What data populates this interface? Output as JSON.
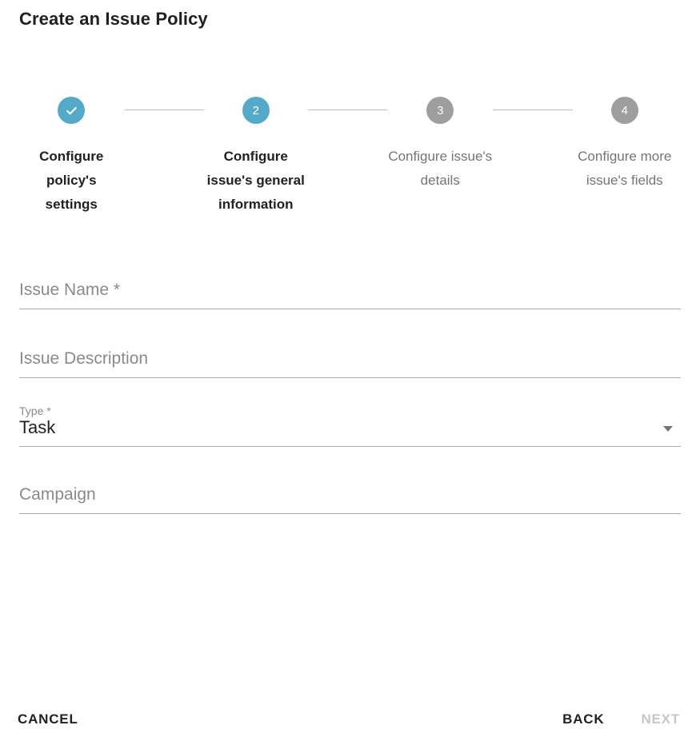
{
  "header": {
    "title": "Create an Issue Policy"
  },
  "colors": {
    "accent": "#54a9c8",
    "inactive": "#9e9e9e",
    "connector": "#bdbdbd",
    "underline": "#ababab",
    "text_primary": "#212121",
    "text_muted": "#757575",
    "placeholder": "#8a8a8a",
    "disabled": "#c6c6c6"
  },
  "stepper": {
    "steps": [
      {
        "number": "1",
        "indicator": "check-icon",
        "label": "Configure policy's settings",
        "state": "completed"
      },
      {
        "number": "2",
        "indicator": "2",
        "label": "Configure issue's general information",
        "state": "active"
      },
      {
        "number": "3",
        "indicator": "3",
        "label": "Configure issue's details",
        "state": "inactive"
      },
      {
        "number": "4",
        "indicator": "4",
        "label": "Configure more issue's fields",
        "state": "inactive"
      }
    ]
  },
  "form": {
    "fields": [
      {
        "name": "issue-name",
        "kind": "text",
        "placeholder": "Issue Name *",
        "label": "Issue Name *",
        "value": "",
        "required": true
      },
      {
        "name": "issue-description",
        "kind": "text",
        "placeholder": "Issue Description",
        "label": "Issue Description",
        "value": "",
        "required": false
      },
      {
        "name": "type",
        "kind": "select",
        "label": "Type *",
        "value": "Task",
        "required": true,
        "icon": "chevron-down-icon"
      },
      {
        "name": "campaign",
        "kind": "text",
        "placeholder": "Campaign",
        "label": "Campaign",
        "value": "",
        "required": false
      }
    ]
  },
  "footer": {
    "cancel_label": "CANCEL",
    "back_label": "BACK",
    "next_label": "NEXT",
    "next_disabled": true
  }
}
